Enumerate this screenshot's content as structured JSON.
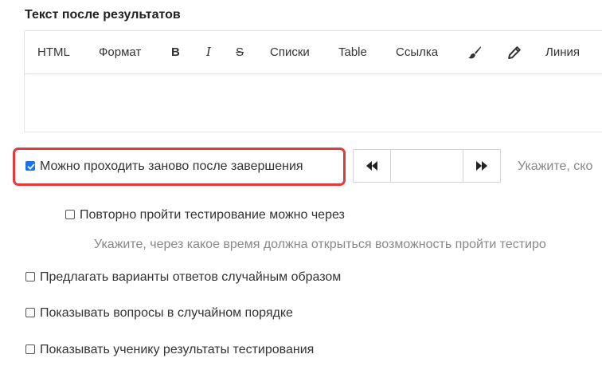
{
  "section": {
    "title": "Текст после результатов"
  },
  "toolbar": {
    "html": "HTML",
    "format": "Формат",
    "bold": "B",
    "italic": "I",
    "strike": "S",
    "lists": "Списки",
    "table": "Table",
    "link": "Ссылка",
    "brush_icon": "brush-icon",
    "pencil_icon": "pencil-icon",
    "line": "Линия"
  },
  "options": {
    "retake": {
      "label": "Можно проходить заново после завершения",
      "checked": true
    },
    "retake_hint": "Укажите, ско",
    "retake_delay": {
      "label": "Повторно пройти тестирование можно через",
      "checked": false
    },
    "retake_delay_hint": "Укажите, через какое время должна открыться возможность пройти тестиро",
    "random_answers": {
      "label": "Предлагать варианты ответов случайным образом",
      "checked": false
    },
    "random_questions": {
      "label": "Показывать вопросы в случайном порядке",
      "checked": false
    },
    "show_results": {
      "label": "Показывать ученику результаты тестирования",
      "checked": false
    }
  },
  "stepper": {
    "value": "",
    "decrease_icon": "double-left-arrow-icon",
    "increase_icon": "double-right-arrow-icon"
  },
  "colors": {
    "accent": "#1a73e8",
    "highlight_border": "#e03a3a"
  }
}
